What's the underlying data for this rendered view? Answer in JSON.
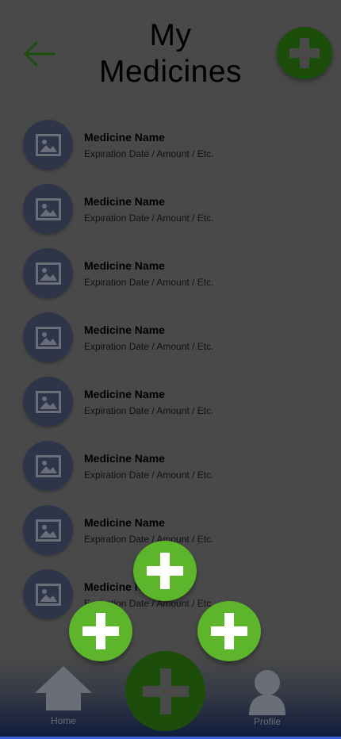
{
  "header": {
    "title_line1": "My",
    "title_line2": "Medicines",
    "back_icon": "arrow-left-icon",
    "add_icon": "plus-icon"
  },
  "medicines": [
    {
      "name": "Medicine Name",
      "details": "Expiration Date / Amount / Etc."
    },
    {
      "name": "Medicine Name",
      "details": "Expiration Date / Amount / Etc."
    },
    {
      "name": "Medicine Name",
      "details": "Expiration Date / Amount / Etc."
    },
    {
      "name": "Medicine Name",
      "details": "Expiration Date / Amount / Etc."
    },
    {
      "name": "Medicine Name",
      "details": "Expiration Date / Amount / Etc."
    },
    {
      "name": "Medicine Name",
      "details": "Expiration Date / Amount / Etc."
    },
    {
      "name": "Medicine Name",
      "details": "Expiration Date / Amount / Etc."
    },
    {
      "name": "Medicine Name",
      "details": "Expiration Date / Amount / Etc."
    }
  ],
  "nav": {
    "home_label": "Home",
    "profile_label": "Profile"
  },
  "colors": {
    "background": "#494949",
    "dark_green": "#1d4d0a",
    "bright_green": "#5cb52a",
    "thumb": "#2e3548",
    "nav_bottom": "#0f1a3c"
  }
}
